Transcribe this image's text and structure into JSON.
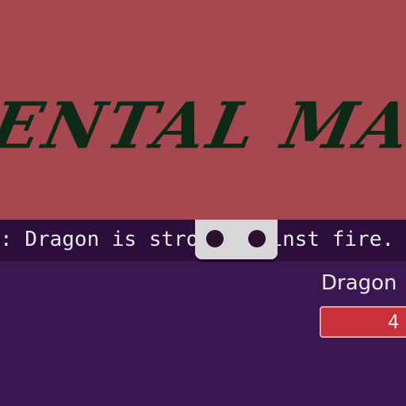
{
  "banner": {
    "title": "ENTAL MAGI"
  },
  "hint": {
    "prefix": "...",
    "sep": ":",
    "text": " Dragon is stro",
    "text_after": "inst fire."
  },
  "enemy": {
    "name": "Dragon",
    "hp_text": "4"
  },
  "colors": {
    "banner": "#a5484f",
    "title": "#0e2a16",
    "background": "#3c1650",
    "hint_bar": "#2a0f3c",
    "hp_bar": "#c9303c",
    "tab_widget": "#d8d6d9"
  },
  "icons": {
    "tab_dots": "two-dot-handle-icon"
  }
}
